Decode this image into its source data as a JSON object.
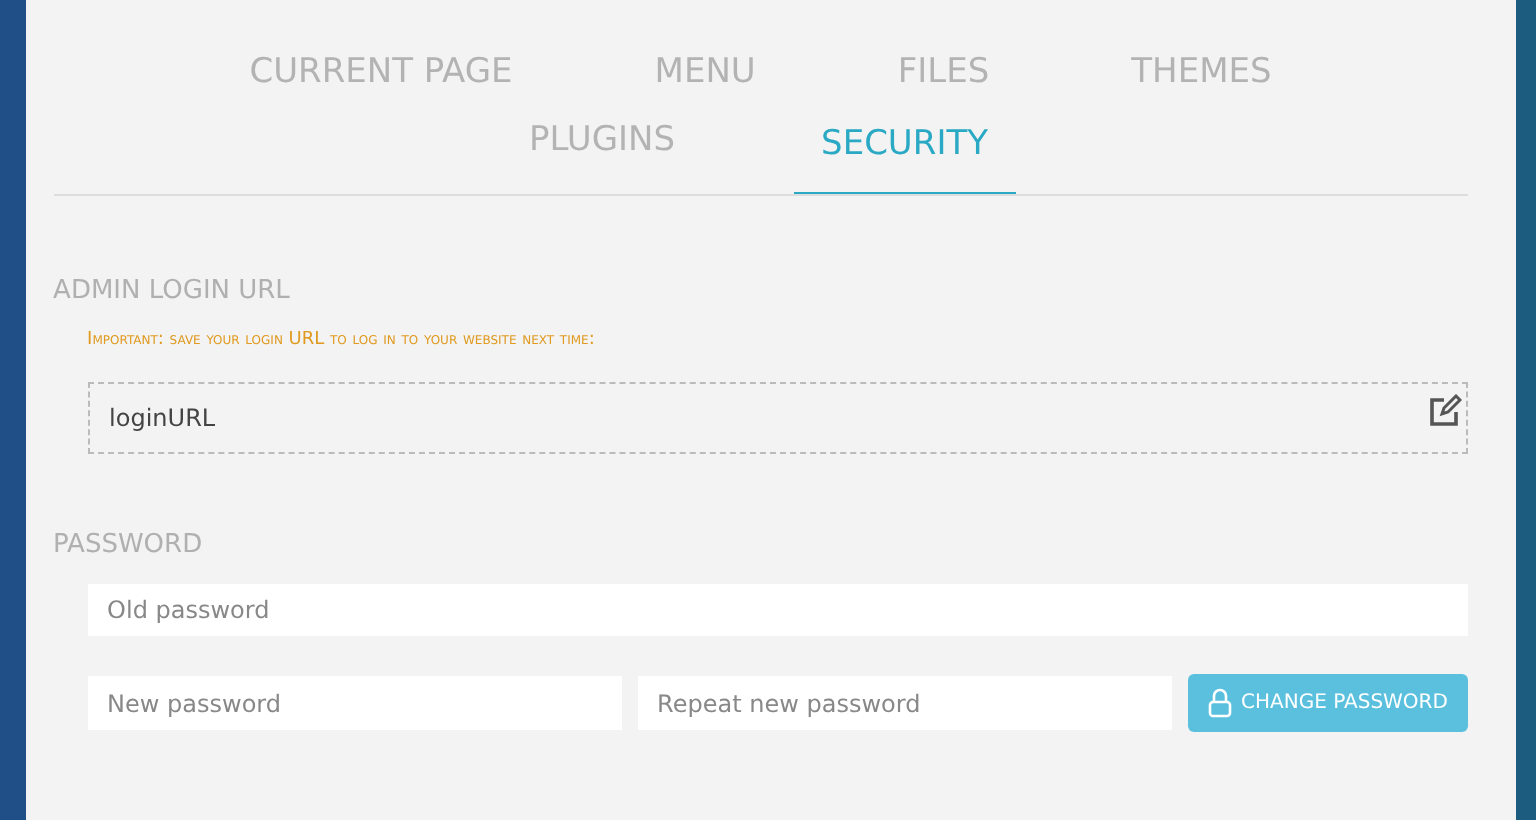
{
  "tabs": [
    {
      "label": "CURRENT PAGE",
      "selected": false
    },
    {
      "label": "MENU",
      "selected": false
    },
    {
      "label": "FILES",
      "selected": false
    },
    {
      "label": "THEMES",
      "selected": false
    },
    {
      "label": "PLUGINS",
      "selected": false
    },
    {
      "label": "SECURITY",
      "selected": true
    }
  ],
  "admin_login": {
    "heading": "ADMIN LOGIN URL",
    "notice": "Important: save your login URL to log in to your website next time:",
    "value": "loginURL"
  },
  "password": {
    "heading": "PASSWORD",
    "old": {
      "placeholder": "Old password"
    },
    "new": {
      "placeholder": "New password"
    },
    "repeat": {
      "placeholder": "Repeat new password"
    },
    "button": "CHANGE PASSWORD"
  }
}
